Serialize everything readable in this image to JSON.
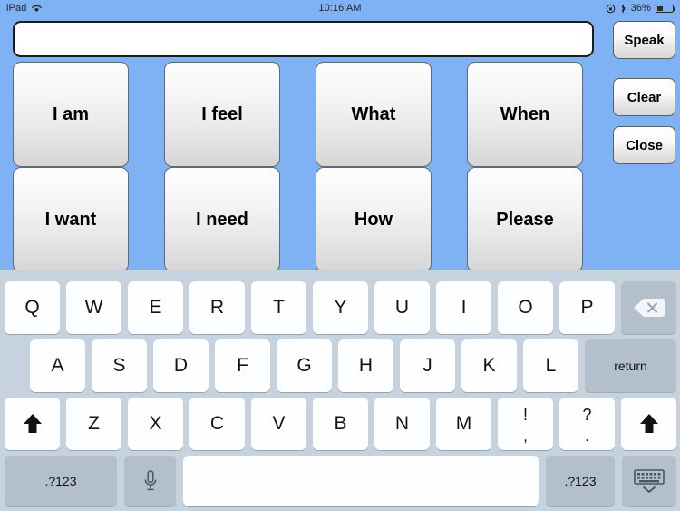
{
  "status_bar": {
    "device_label": "iPad",
    "wifi_icon": "wifi-icon",
    "time": "10:16 AM",
    "rotation_lock_icon": "rotation-lock-icon",
    "bluetooth_icon": "bluetooth-icon",
    "battery_percent": "36%",
    "battery_icon": "battery-icon"
  },
  "app": {
    "text_field_value": "",
    "text_field_placeholder": "",
    "side_buttons": [
      {
        "label": "Speak",
        "name": "speak-button"
      },
      {
        "label": "Clear",
        "name": "clear-button"
      },
      {
        "label": "Close",
        "name": "close-button"
      }
    ],
    "phrase_buttons": [
      {
        "label": "I am"
      },
      {
        "label": "I feel"
      },
      {
        "label": "What"
      },
      {
        "label": "When"
      },
      {
        "label": "I want"
      },
      {
        "label": "I need"
      },
      {
        "label": "How"
      },
      {
        "label": "Please"
      }
    ]
  },
  "keyboard": {
    "row1": [
      "Q",
      "W",
      "E",
      "R",
      "T",
      "Y",
      "U",
      "I",
      "O",
      "P"
    ],
    "row1_extra": {
      "label": "",
      "icon": "backspace-icon"
    },
    "row2": [
      "A",
      "S",
      "D",
      "F",
      "G",
      "H",
      "J",
      "K",
      "L"
    ],
    "row2_extra": {
      "label": "return",
      "icon": "return-key"
    },
    "row3": [
      "Z",
      "X",
      "C",
      "V",
      "B",
      "N",
      "M"
    ],
    "row3_shift_left_icon": "shift-icon",
    "row3_shift_right_icon": "shift-icon",
    "row3_punct1": {
      "top": "!",
      "bottom": ","
    },
    "row3_punct2": {
      "top": "?",
      "bottom": "."
    },
    "row4": {
      "numbers_left": ".?123",
      "mic_icon": "microphone-icon",
      "space_label": "",
      "numbers_right": ".?123",
      "hide_keyboard_icon": "hide-keyboard-icon"
    }
  },
  "colors": {
    "app_background": "#7FB2F5",
    "keyboard_background": "#C6D3DE",
    "key_light": "#FDFEFF",
    "key_dark": "#B3C0CC",
    "text": "#111214"
  }
}
